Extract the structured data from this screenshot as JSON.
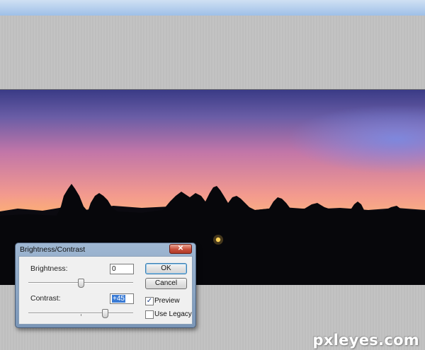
{
  "watermark": "pxleyes.com",
  "dialog": {
    "title": "Brightness/Contrast",
    "close_glyph": "✕",
    "brightness": {
      "label": "Brightness:",
      "value": "0",
      "slider_fraction": 0.5
    },
    "contrast": {
      "label": "Contrast:",
      "value": "+45",
      "slider_fraction": 0.6
    },
    "buttons": {
      "ok": "OK",
      "cancel": "Cancel"
    },
    "checkboxes": {
      "preview": {
        "label": "Preview",
        "checked": true,
        "glyph": "✓"
      },
      "use_legacy": {
        "label": "Use Legacy",
        "checked": false
      }
    }
  },
  "colors": {
    "close_button": "#c9503c",
    "selection": "#3a7bd5"
  }
}
